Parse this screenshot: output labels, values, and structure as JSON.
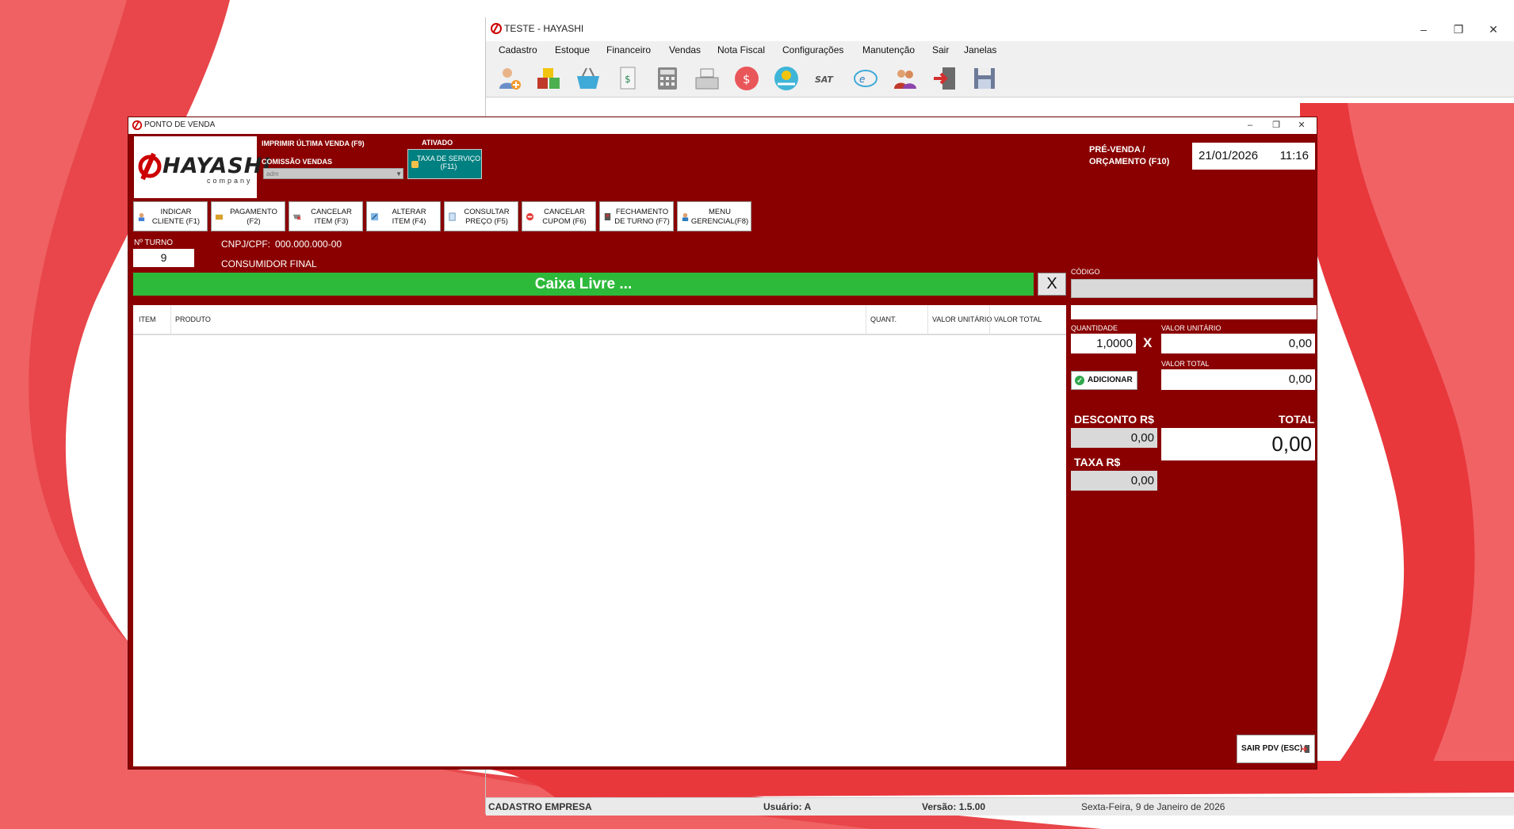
{
  "main_window": {
    "title": "TESTE - HAYASHI",
    "menu": [
      "Cadastro",
      "Estoque",
      "Financeiro",
      "Vendas",
      "Nota Fiscal",
      "Configurações",
      "Manutenção",
      "Sair",
      "Janelas"
    ],
    "toolbar_icons": [
      "add-client-icon",
      "products-icon",
      "basket-icon",
      "document-icon",
      "calculator-icon",
      "cash-register-icon",
      "money-bag-icon",
      "payment-icon",
      "sat-icon",
      "nfe-icon",
      "users-icon",
      "exit-door-icon",
      "save-icon"
    ],
    "status": {
      "empresa": "CADASTRO EMPRESA",
      "usuario": "Usuário: A",
      "versao": "Versão: 1.5.00",
      "data": "Sexta-Feira, 9 de Janeiro de 2026"
    }
  },
  "pdv": {
    "title": "PONTO DE VENDA",
    "logo_text": "HAYASHI",
    "logo_sub": "company",
    "imprimir_label": "IMPRIMIR ÚLTIMA VENDA (F9)",
    "comissao_label": "COMISSÃO VENDAS",
    "comissao_value": "adm",
    "ativado_label": "ATIVADO",
    "taxa_button": "TAXA DE SERVIÇO (F11)",
    "pre_venda_line1": "PRÉ-VENDA /",
    "pre_venda_line2": "ORÇAMENTO (F10)",
    "date": "21/01/2026",
    "time": "11:16",
    "function_buttons": [
      {
        "l1": "INDICAR",
        "l2": "CLIENTE (F1)"
      },
      {
        "l1": "PAGAMENTO",
        "l2": "(F2)"
      },
      {
        "l1": "CANCELAR",
        "l2": "ITEM (F3)"
      },
      {
        "l1": "ALTERAR",
        "l2": "ITEM (F4)"
      },
      {
        "l1": "CONSULTAR",
        "l2": "PREÇO (F5)"
      },
      {
        "l1": "CANCELAR",
        "l2": "CUPOM (F6)"
      },
      {
        "l1": "FECHAMENTO",
        "l2": "DE TURNO (F7)"
      },
      {
        "l1": "MENU",
        "l2": "GERENCIAL(F8)"
      }
    ],
    "turno_label": "Nº TURNO",
    "turno_value": "9",
    "cnpj_label": "CNPJ/CPF:",
    "cnpj_value": "000.000.000-00",
    "consumidor": "CONSUMIDOR FINAL",
    "caixa_status": "Caixa Livre ...",
    "close_x": "X",
    "grid_headers": [
      "ITEM",
      "PRODUTO",
      "QUANT.",
      "VALOR UNITÁRIO",
      "VALOR TOTAL"
    ],
    "codigo_label": "CÓDIGO",
    "quantidade_label": "QUANTIDADE",
    "quantidade_value": "1,0000",
    "mult_sign": "X",
    "valor_unitario_label": "VALOR UNITÁRIO",
    "valor_unitario_value": "0,00",
    "valor_total_label": "VALOR TOTAL",
    "valor_total_value": "0,00",
    "adicionar": "ADICIONAR",
    "desconto_label": "DESCONTO R$",
    "desconto_value": "0,00",
    "total_label": "TOTAL",
    "total_value": "0,00",
    "taxa_label": "TAXA R$",
    "taxa_value": "0,00",
    "sair_pdv": "SAIR PDV (ESC)"
  },
  "colors": {
    "pdv_background": "#8a0000",
    "caixa_bar": "#2db93a",
    "taxa_button": "#008080",
    "wallpaper_red": "#e8383c"
  }
}
